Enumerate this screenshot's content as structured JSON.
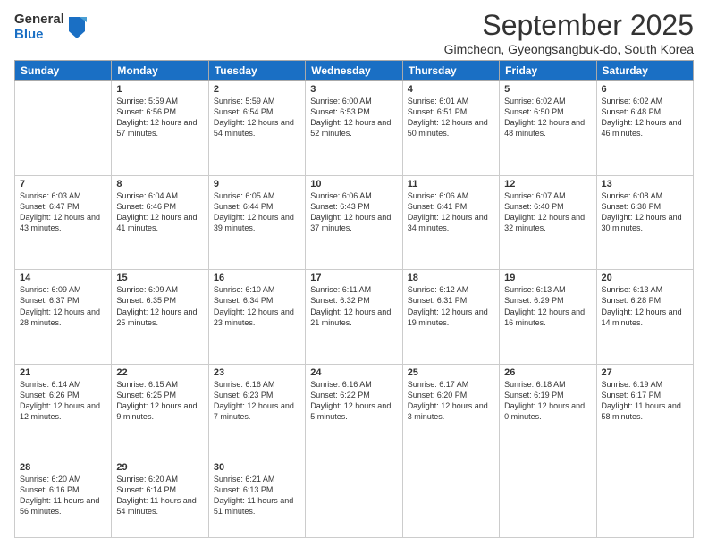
{
  "logo": {
    "general": "General",
    "blue": "Blue"
  },
  "title": "September 2025",
  "location": "Gimcheon, Gyeongsangbuk-do, South Korea",
  "weekdays": [
    "Sunday",
    "Monday",
    "Tuesday",
    "Wednesday",
    "Thursday",
    "Friday",
    "Saturday"
  ],
  "weeks": [
    [
      {
        "day": "",
        "sunrise": "",
        "sunset": "",
        "daylight": ""
      },
      {
        "day": "1",
        "sunrise": "Sunrise: 5:59 AM",
        "sunset": "Sunset: 6:56 PM",
        "daylight": "Daylight: 12 hours and 57 minutes."
      },
      {
        "day": "2",
        "sunrise": "Sunrise: 5:59 AM",
        "sunset": "Sunset: 6:54 PM",
        "daylight": "Daylight: 12 hours and 54 minutes."
      },
      {
        "day": "3",
        "sunrise": "Sunrise: 6:00 AM",
        "sunset": "Sunset: 6:53 PM",
        "daylight": "Daylight: 12 hours and 52 minutes."
      },
      {
        "day": "4",
        "sunrise": "Sunrise: 6:01 AM",
        "sunset": "Sunset: 6:51 PM",
        "daylight": "Daylight: 12 hours and 50 minutes."
      },
      {
        "day": "5",
        "sunrise": "Sunrise: 6:02 AM",
        "sunset": "Sunset: 6:50 PM",
        "daylight": "Daylight: 12 hours and 48 minutes."
      },
      {
        "day": "6",
        "sunrise": "Sunrise: 6:02 AM",
        "sunset": "Sunset: 6:48 PM",
        "daylight": "Daylight: 12 hours and 46 minutes."
      }
    ],
    [
      {
        "day": "7",
        "sunrise": "Sunrise: 6:03 AM",
        "sunset": "Sunset: 6:47 PM",
        "daylight": "Daylight: 12 hours and 43 minutes."
      },
      {
        "day": "8",
        "sunrise": "Sunrise: 6:04 AM",
        "sunset": "Sunset: 6:46 PM",
        "daylight": "Daylight: 12 hours and 41 minutes."
      },
      {
        "day": "9",
        "sunrise": "Sunrise: 6:05 AM",
        "sunset": "Sunset: 6:44 PM",
        "daylight": "Daylight: 12 hours and 39 minutes."
      },
      {
        "day": "10",
        "sunrise": "Sunrise: 6:06 AM",
        "sunset": "Sunset: 6:43 PM",
        "daylight": "Daylight: 12 hours and 37 minutes."
      },
      {
        "day": "11",
        "sunrise": "Sunrise: 6:06 AM",
        "sunset": "Sunset: 6:41 PM",
        "daylight": "Daylight: 12 hours and 34 minutes."
      },
      {
        "day": "12",
        "sunrise": "Sunrise: 6:07 AM",
        "sunset": "Sunset: 6:40 PM",
        "daylight": "Daylight: 12 hours and 32 minutes."
      },
      {
        "day": "13",
        "sunrise": "Sunrise: 6:08 AM",
        "sunset": "Sunset: 6:38 PM",
        "daylight": "Daylight: 12 hours and 30 minutes."
      }
    ],
    [
      {
        "day": "14",
        "sunrise": "Sunrise: 6:09 AM",
        "sunset": "Sunset: 6:37 PM",
        "daylight": "Daylight: 12 hours and 28 minutes."
      },
      {
        "day": "15",
        "sunrise": "Sunrise: 6:09 AM",
        "sunset": "Sunset: 6:35 PM",
        "daylight": "Daylight: 12 hours and 25 minutes."
      },
      {
        "day": "16",
        "sunrise": "Sunrise: 6:10 AM",
        "sunset": "Sunset: 6:34 PM",
        "daylight": "Daylight: 12 hours and 23 minutes."
      },
      {
        "day": "17",
        "sunrise": "Sunrise: 6:11 AM",
        "sunset": "Sunset: 6:32 PM",
        "daylight": "Daylight: 12 hours and 21 minutes."
      },
      {
        "day": "18",
        "sunrise": "Sunrise: 6:12 AM",
        "sunset": "Sunset: 6:31 PM",
        "daylight": "Daylight: 12 hours and 19 minutes."
      },
      {
        "day": "19",
        "sunrise": "Sunrise: 6:13 AM",
        "sunset": "Sunset: 6:29 PM",
        "daylight": "Daylight: 12 hours and 16 minutes."
      },
      {
        "day": "20",
        "sunrise": "Sunrise: 6:13 AM",
        "sunset": "Sunset: 6:28 PM",
        "daylight": "Daylight: 12 hours and 14 minutes."
      }
    ],
    [
      {
        "day": "21",
        "sunrise": "Sunrise: 6:14 AM",
        "sunset": "Sunset: 6:26 PM",
        "daylight": "Daylight: 12 hours and 12 minutes."
      },
      {
        "day": "22",
        "sunrise": "Sunrise: 6:15 AM",
        "sunset": "Sunset: 6:25 PM",
        "daylight": "Daylight: 12 hours and 9 minutes."
      },
      {
        "day": "23",
        "sunrise": "Sunrise: 6:16 AM",
        "sunset": "Sunset: 6:23 PM",
        "daylight": "Daylight: 12 hours and 7 minutes."
      },
      {
        "day": "24",
        "sunrise": "Sunrise: 6:16 AM",
        "sunset": "Sunset: 6:22 PM",
        "daylight": "Daylight: 12 hours and 5 minutes."
      },
      {
        "day": "25",
        "sunrise": "Sunrise: 6:17 AM",
        "sunset": "Sunset: 6:20 PM",
        "daylight": "Daylight: 12 hours and 3 minutes."
      },
      {
        "day": "26",
        "sunrise": "Sunrise: 6:18 AM",
        "sunset": "Sunset: 6:19 PM",
        "daylight": "Daylight: 12 hours and 0 minutes."
      },
      {
        "day": "27",
        "sunrise": "Sunrise: 6:19 AM",
        "sunset": "Sunset: 6:17 PM",
        "daylight": "Daylight: 11 hours and 58 minutes."
      }
    ],
    [
      {
        "day": "28",
        "sunrise": "Sunrise: 6:20 AM",
        "sunset": "Sunset: 6:16 PM",
        "daylight": "Daylight: 11 hours and 56 minutes."
      },
      {
        "day": "29",
        "sunrise": "Sunrise: 6:20 AM",
        "sunset": "Sunset: 6:14 PM",
        "daylight": "Daylight: 11 hours and 54 minutes."
      },
      {
        "day": "30",
        "sunrise": "Sunrise: 6:21 AM",
        "sunset": "Sunset: 6:13 PM",
        "daylight": "Daylight: 11 hours and 51 minutes."
      },
      {
        "day": "",
        "sunrise": "",
        "sunset": "",
        "daylight": ""
      },
      {
        "day": "",
        "sunrise": "",
        "sunset": "",
        "daylight": ""
      },
      {
        "day": "",
        "sunrise": "",
        "sunset": "",
        "daylight": ""
      },
      {
        "day": "",
        "sunrise": "",
        "sunset": "",
        "daylight": ""
      }
    ]
  ]
}
